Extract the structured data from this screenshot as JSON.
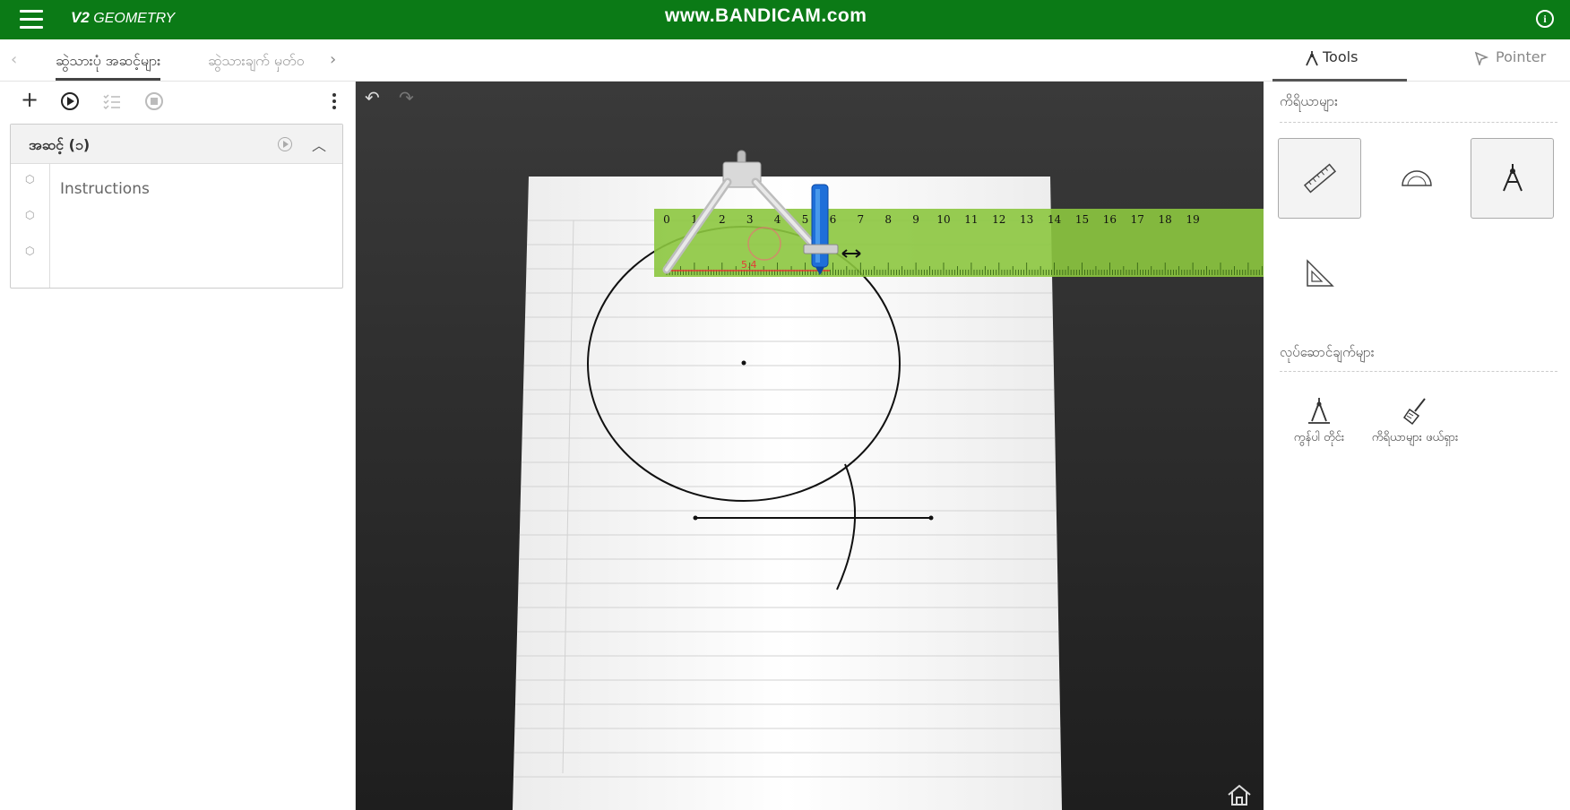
{
  "app": {
    "brand_bold": "V2",
    "brand_rest": "GEOMETRY",
    "watermark": "www.BANDICAM.com",
    "info_icon": "i"
  },
  "tabs": [
    {
      "label": "ဆွဲသားပုံ အဆင့်များ",
      "active": true
    },
    {
      "label": "ဆွဲသားချက် မှတ်ဝ",
      "active": false
    }
  ],
  "steps_panel": {
    "step_title": "အဆင့် (၁)",
    "instructions_placeholder": "Instructions"
  },
  "right_panel": {
    "tabs": [
      {
        "label": "Tools",
        "icon": "compass-icon",
        "active": true
      },
      {
        "label": "Pointer",
        "icon": "pointer-icon",
        "active": false
      }
    ],
    "tools_section": "ကိရိယာများ",
    "actions_section": "လုပ်ဆောင်ချက်များ",
    "tools": [
      {
        "name": "ruler",
        "icon": "ruler-icon",
        "selected": true
      },
      {
        "name": "protractor",
        "icon": "protractor-icon",
        "selected": false
      },
      {
        "name": "compass",
        "icon": "compass-icon",
        "selected": true
      },
      {
        "name": "set-square",
        "icon": "set-square-icon",
        "selected": false
      }
    ],
    "actions": [
      {
        "label": "ကွန်ပါ တိုင်း",
        "icon": "compass-measure-icon"
      },
      {
        "label": "ကိရိယာများ ဖယ်ရှား",
        "icon": "broom-icon"
      }
    ]
  },
  "ruler": {
    "ticks": [
      "0",
      "1",
      "2",
      "3",
      "4",
      "5",
      "6",
      "7",
      "8",
      "9",
      "10",
      "11",
      "12",
      "13",
      "14",
      "15",
      "16",
      "17",
      "18",
      "19"
    ],
    "compass_reading": "5.4"
  },
  "colors": {
    "topbar": "#0b7a16",
    "ruler": "#8cc63f",
    "pencil": "#1e6fd9",
    "canvas_bg": "#2b2b2b"
  }
}
